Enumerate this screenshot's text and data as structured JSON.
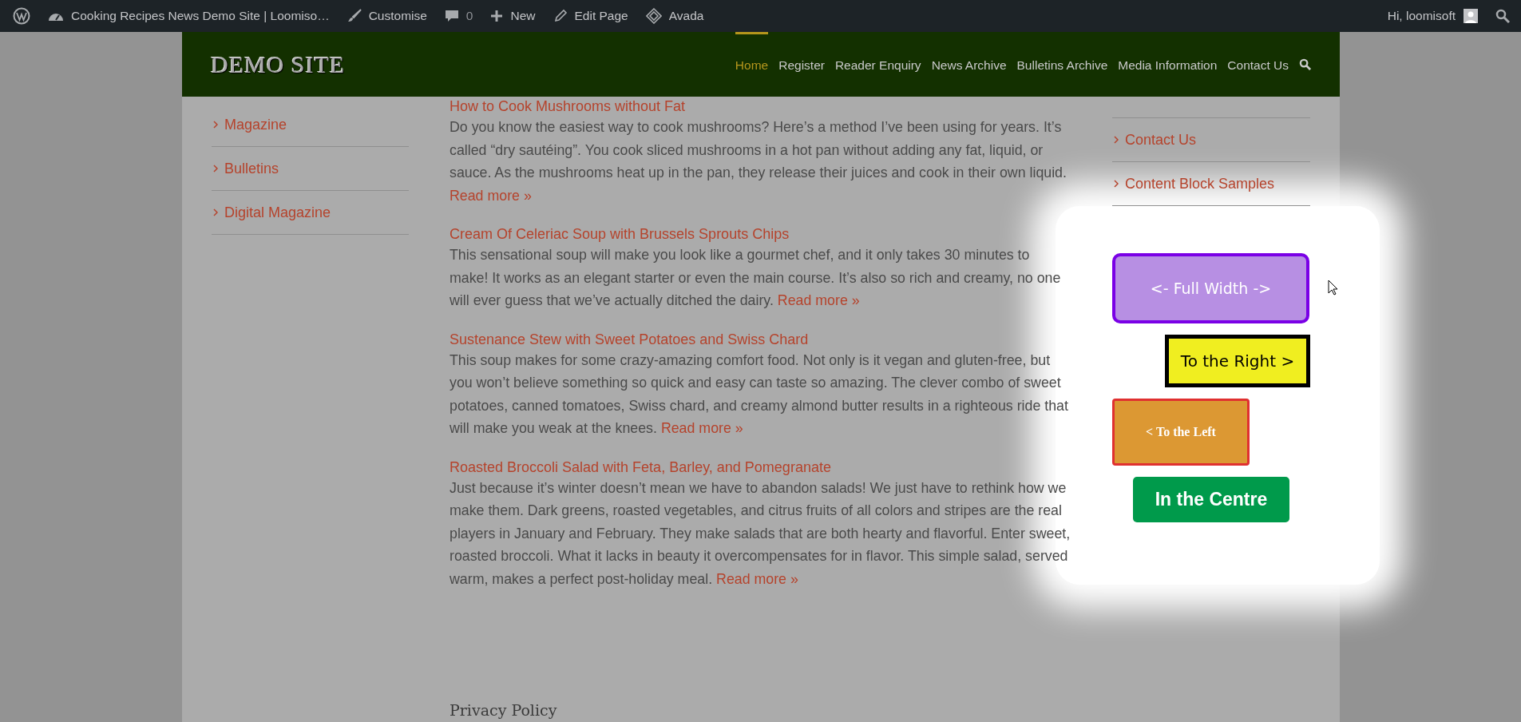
{
  "admin_bar": {
    "site": "Cooking Recipes News Demo Site | Loomiso…",
    "customise": "Customise",
    "comments": "0",
    "new": "New",
    "edit": "Edit Page",
    "theme": "Avada",
    "greeting": "Hi, loomisoft"
  },
  "header": {
    "logo": "DEMO SITE",
    "nav": [
      {
        "label": "Home",
        "selected": true
      },
      {
        "label": "Register",
        "selected": false
      },
      {
        "label": "Reader Enquiry",
        "selected": false
      },
      {
        "label": "News Archive",
        "selected": false
      },
      {
        "label": "Bulletins Archive",
        "selected": false
      },
      {
        "label": "Media Information",
        "selected": false
      },
      {
        "label": "Contact Us",
        "selected": false
      }
    ]
  },
  "left_sidebar": {
    "items": [
      "Magazine",
      "Bulletins",
      "Digital Magazine"
    ]
  },
  "articles": [
    {
      "title": "How to Cook Mushrooms without Fat",
      "text": "Do you know the easiest way to cook mushrooms? Here’s a method I’ve been using for years. It’s called “dry sautéing”. You cook sliced mushrooms in a hot pan without adding any fat, liquid, or sauce. As the mushrooms heat up in the pan, they release their juices and cook in their own liquid.",
      "link": "Read more »"
    },
    {
      "title": "Cream Of Celeriac Soup with Brussels Sprouts Chips",
      "text": "This sensational soup will make you look like a gourmet chef, and it only takes 30 minutes to make! It works as an elegant starter or even the main course. It’s also so rich and creamy, no one will ever guess that we’ve actually ditched the dairy.",
      "link": "Read more »"
    },
    {
      "title": "Sustenance Stew with Sweet Potatoes and Swiss Chard",
      "text": "This soup makes for some crazy-amazing comfort food. Not only is it vegan and gluten-free, but you won’t believe something so quick and easy can taste so amazing. The clever combo of sweet potatoes, canned tomatoes, Swiss chard, and creamy almond butter results in a righteous ride that will make you weak at the knees.",
      "link": "Read more »"
    },
    {
      "title": "Roasted Broccoli Salad with Feta, Barley, and Pomegranate",
      "text": "Just because it’s winter doesn’t mean we have to abandon salads! We just have to rethink how we make them. Dark greens, roasted vegetables, and citrus fruits of all colors and stripes are the real players in January and February. They make salads that are both hearty and flavorful. Enter sweet, roasted broccoli. What it lacks in beauty it overcompensates for in flavor. This simple salad, served warm, makes a perfect post-holiday meal.",
      "link": "Read more »"
    }
  ],
  "right_sidebar": {
    "items": [
      "Contact Us",
      "Content Block Samples"
    ]
  },
  "buttons": [
    {
      "label": "<- Full Width ->",
      "kind": "full"
    },
    {
      "label": "To the Right >",
      "kind": "right"
    },
    {
      "label": "< To the Left",
      "kind": "left"
    },
    {
      "label": "In the Centre",
      "kind": "centre"
    }
  ],
  "footer": {
    "title": "Privacy Policy"
  }
}
